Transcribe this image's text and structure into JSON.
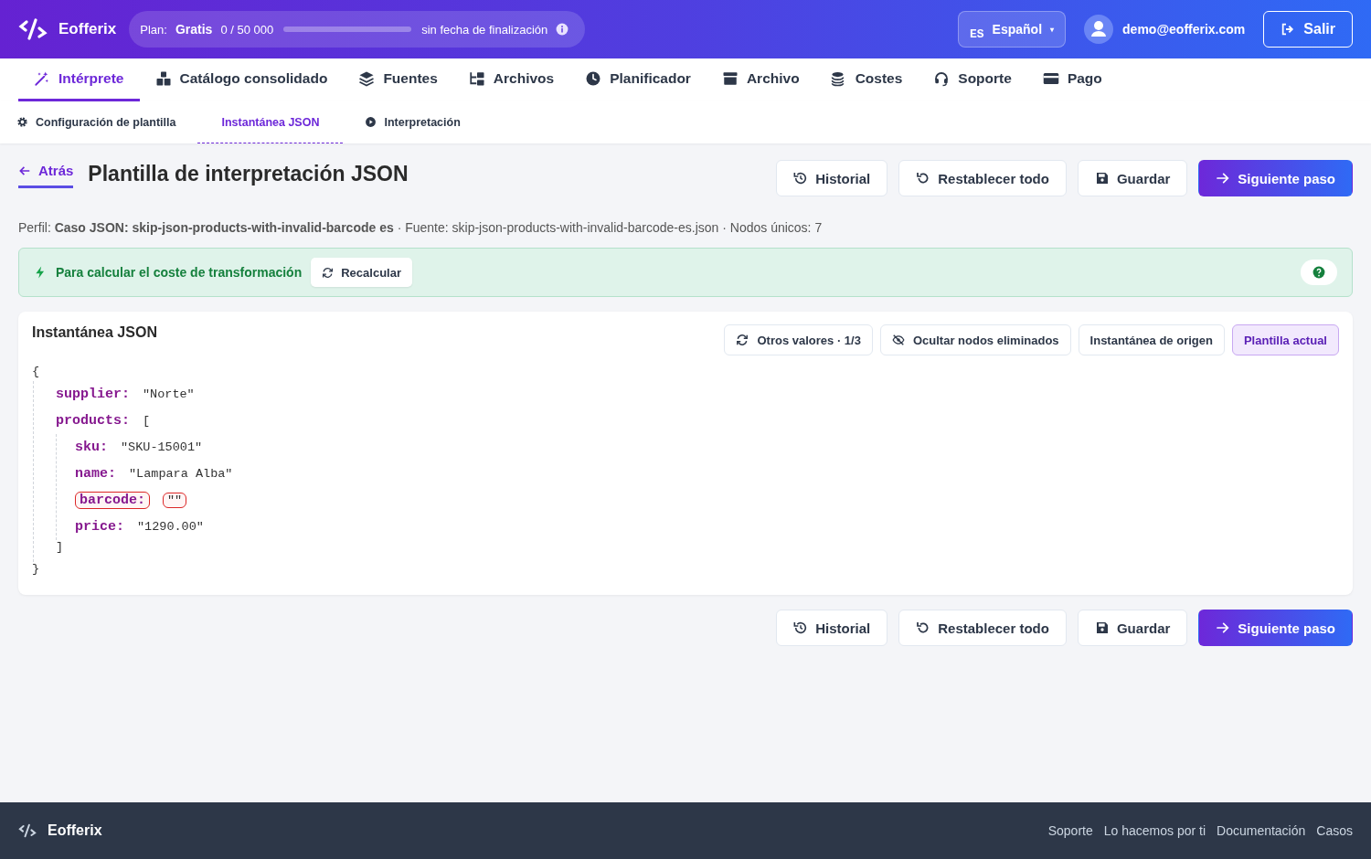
{
  "header": {
    "brand": "Eofferix",
    "plan": {
      "label": "Plan:",
      "name": "Gratis",
      "usage": "0 / 50 000",
      "level": 0,
      "expiry": "sin fecha de finalización"
    },
    "language": {
      "code": "ES",
      "label": "Español",
      "caret": "▾"
    },
    "user": {
      "email": "demo@eofferix.com"
    },
    "logout": "Salir"
  },
  "nav": {
    "tabs": [
      {
        "label": "Intérprete",
        "selected": true
      },
      {
        "label": "Catálogo consolidado",
        "selected": false
      },
      {
        "label": "Fuentes",
        "selected": false
      },
      {
        "label": "Archivos",
        "selected": false
      },
      {
        "label": "Planificador",
        "selected": false
      },
      {
        "label": "Archivo",
        "selected": false
      },
      {
        "label": "Costes",
        "selected": false
      },
      {
        "label": "Soporte",
        "selected": false
      },
      {
        "label": "Pago",
        "selected": false
      }
    ]
  },
  "subtabs": [
    {
      "label": "Configuración de plantilla",
      "selected": false
    },
    {
      "label": "Instantánea JSON",
      "selected": true
    },
    {
      "label": "Interpretación",
      "selected": false
    }
  ],
  "page": {
    "back": "Atrás",
    "title": "Plantilla de interpretación JSON",
    "actions": [
      {
        "label": "Historial",
        "kind": "secondary"
      },
      {
        "label": "Restablecer todo",
        "kind": "secondary"
      },
      {
        "label": "Guardar",
        "kind": "secondary"
      },
      {
        "label": "Siguiente paso",
        "kind": "primary"
      }
    ],
    "profile": "Perfil: **Caso JSON: skip-json-products-with-invalid-barcode es** · Fuente: skip-json-products-with-invalid-barcode-es.json · Nodos únicos: 7"
  },
  "notice": {
    "text": "Para calcular el coste de transformación",
    "button": "Recalcular"
  },
  "snapshot": {
    "title": "Instantánea JSON",
    "toggles": [
      {
        "label": "Otros valores · 1/3",
        "selected": false
      },
      {
        "label": "Ocultar nodos eliminados",
        "selected": false
      },
      {
        "label": "Instantánea de origen",
        "selected": false
      },
      {
        "label": "Plantilla actual",
        "selected": true
      }
    ],
    "tree": {
      "open": "{",
      "close": "}",
      "children": [
        {
          "key": "supplier:",
          "value": "\"Norte\"",
          "invalid": false
        },
        {
          "key": "products:",
          "open": "[",
          "close": "]",
          "children": [
            {
              "key": "sku:",
              "value": "\"SKU-15001\"",
              "invalid": false
            },
            {
              "key": "name:",
              "value": "\"Lampara Alba\"",
              "invalid": false
            },
            {
              "key": "barcode:",
              "value": "\"\"",
              "invalid": true
            },
            {
              "key": "price:",
              "value": "\"1290.00\"",
              "invalid": false
            }
          ]
        }
      ]
    }
  },
  "bottom_actions": [
    {
      "label": "Historial",
      "kind": "secondary"
    },
    {
      "label": "Restablecer todo",
      "kind": "secondary"
    },
    {
      "label": "Guardar",
      "kind": "secondary"
    },
    {
      "label": "Siguiente paso",
      "kind": "primary"
    }
  ],
  "footer": {
    "brand": "Eofferix",
    "links": [
      "Soporte",
      "Lo hacemos por ti",
      "Documentación",
      "Casos"
    ]
  }
}
